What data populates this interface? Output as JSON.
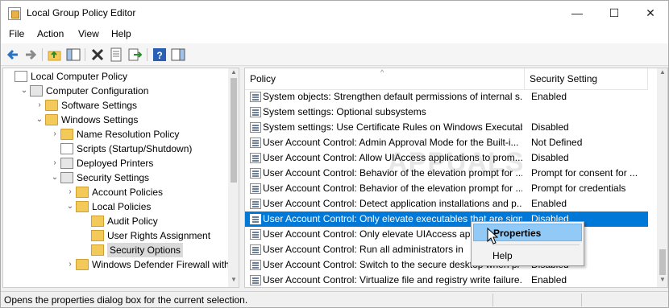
{
  "window": {
    "title": "Local Group Policy Editor",
    "minimize_glyph": "—",
    "maximize_glyph": "☐",
    "close_glyph": "✕"
  },
  "menu": [
    "File",
    "Action",
    "View",
    "Help"
  ],
  "toolbar_icons": [
    "back-icon",
    "forward-icon",
    "up-folder-icon",
    "show-hide-tree-icon",
    "delete-icon",
    "properties-icon",
    "export-list-icon",
    "help-icon",
    "show-hide-action-pane-icon"
  ],
  "tree": [
    {
      "label": "Local Computer Policy",
      "level": 0,
      "icon": "computer-policy-icon",
      "expander": ""
    },
    {
      "label": "Computer Configuration",
      "level": 1,
      "icon": "computer-icon",
      "expander": "⌄"
    },
    {
      "label": "Software Settings",
      "level": 2,
      "icon": "folder-icon",
      "expander": "›"
    },
    {
      "label": "Windows Settings",
      "level": 2,
      "icon": "folder-icon",
      "expander": "⌄"
    },
    {
      "label": "Name Resolution Policy",
      "level": 3,
      "icon": "folder-icon",
      "expander": "›"
    },
    {
      "label": "Scripts (Startup/Shutdown)",
      "level": 3,
      "icon": "script-icon",
      "expander": ""
    },
    {
      "label": "Deployed Printers",
      "level": 3,
      "icon": "printer-icon",
      "expander": "›"
    },
    {
      "label": "Security Settings",
      "level": 3,
      "icon": "security-settings-icon",
      "expander": "⌄"
    },
    {
      "label": "Account Policies",
      "level": 4,
      "icon": "locked-folder-icon",
      "expander": "›"
    },
    {
      "label": "Local Policies",
      "level": 4,
      "icon": "locked-folder-icon",
      "expander": "⌄"
    },
    {
      "label": "Audit Policy",
      "level": 5,
      "icon": "locked-folder-icon",
      "expander": ""
    },
    {
      "label": "User Rights Assignment",
      "level": 5,
      "icon": "locked-folder-icon",
      "expander": ""
    },
    {
      "label": "Security Options",
      "level": 5,
      "icon": "locked-folder-icon",
      "expander": "",
      "selected": true
    },
    {
      "label": "Windows Defender Firewall with A",
      "level": 4,
      "icon": "folder-icon",
      "expander": "›"
    }
  ],
  "list": {
    "columns": {
      "policy": "Policy",
      "setting": "Security Setting"
    },
    "rows": [
      {
        "policy": "System objects: Strengthen default permissions of internal s...",
        "setting": "Enabled"
      },
      {
        "policy": "System settings: Optional subsystems",
        "setting": ""
      },
      {
        "policy": "System settings: Use Certificate Rules on Windows Executabl...",
        "setting": "Disabled"
      },
      {
        "policy": "User Account Control: Admin Approval Mode for the Built-i...",
        "setting": "Not Defined"
      },
      {
        "policy": "User Account Control: Allow UIAccess applications to prom...",
        "setting": "Disabled"
      },
      {
        "policy": "User Account Control: Behavior of the elevation prompt for ...",
        "setting": "Prompt for consent for ..."
      },
      {
        "policy": "User Account Control: Behavior of the elevation prompt for ...",
        "setting": "Prompt for credentials"
      },
      {
        "policy": "User Account Control: Detect application installations and p...",
        "setting": "Enabled"
      },
      {
        "policy": "User Account Control: Only elevate executables that are sign...",
        "setting": "Disabled",
        "selected": true
      },
      {
        "policy": "User Account Control: Only elevate UIAccess ap",
        "setting": ""
      },
      {
        "policy": "User Account Control: Run all administrators in",
        "setting": ""
      },
      {
        "policy": "User Account Control: Switch to the secure desktop when pr",
        "setting": "Disabled"
      },
      {
        "policy": "User Account Control: Virtualize file and registry write failure...",
        "setting": "Enabled"
      }
    ]
  },
  "context_menu": {
    "items": [
      "Properties",
      "Help"
    ],
    "highlighted": "Properties"
  },
  "watermark": "APPUALS",
  "status": {
    "text": "Opens the properties dialog box for the current selection."
  },
  "colors": {
    "selection": "#0078d7",
    "menu_hover": "#91c9f7"
  }
}
